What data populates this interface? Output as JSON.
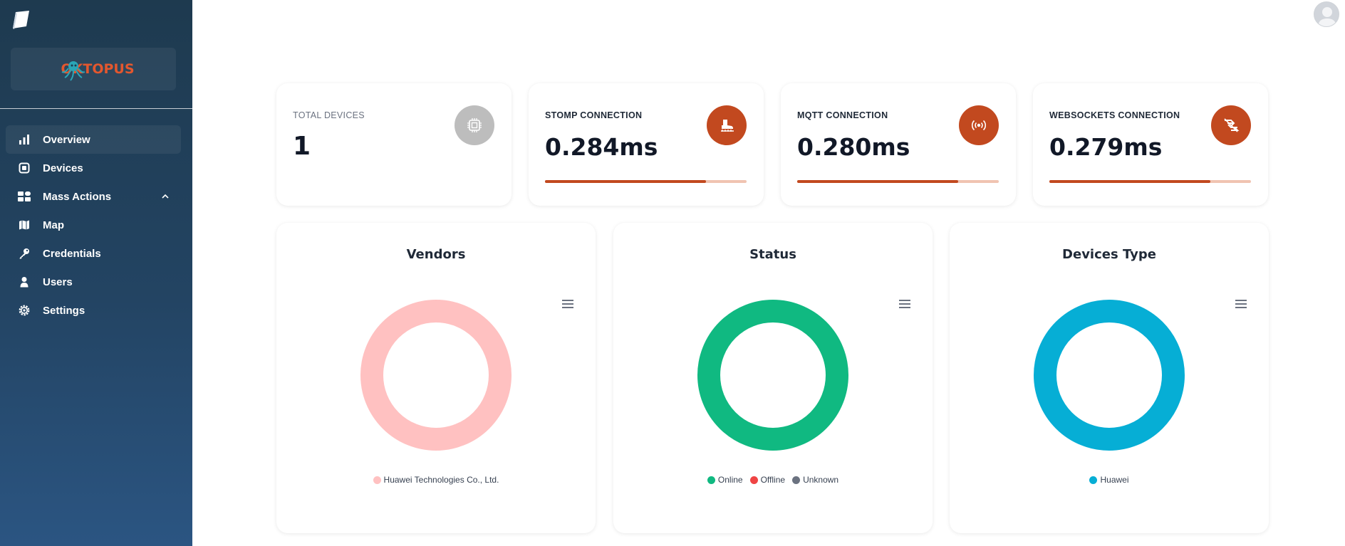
{
  "app": {
    "logo_text": "OKTOPUS"
  },
  "sidebar": {
    "items": [
      {
        "label": "Overview",
        "icon": "bar-chart-icon",
        "active": true
      },
      {
        "label": "Devices",
        "icon": "chip-icon"
      },
      {
        "label": "Mass Actions",
        "icon": "grid-icon",
        "expandable": true
      },
      {
        "label": "Map",
        "icon": "map-icon"
      },
      {
        "label": "Credentials",
        "icon": "key-icon"
      },
      {
        "label": "Users",
        "icon": "user-icon"
      },
      {
        "label": "Settings",
        "icon": "gear-icon"
      }
    ]
  },
  "stats": [
    {
      "label": "TOTAL DEVICES",
      "value": "1",
      "icon": "chip-icon",
      "badge_color": "#bdbdbd"
    },
    {
      "label": "STOMP CONNECTION",
      "value": "0.284ms",
      "icon": "stomp-icon",
      "badge_color": "#c2491f",
      "progress": 0.8
    },
    {
      "label": "MQTT CONNECTION",
      "value": "0.280ms",
      "icon": "broadcast-icon",
      "badge_color": "#c2491f",
      "progress": 0.8
    },
    {
      "label": "WEBSOCKETS CONNECTION",
      "value": "0.279ms",
      "icon": "websocket-icon",
      "badge_color": "#c2491f",
      "progress": 0.8
    }
  ],
  "charts": [
    {
      "title": "Vendors",
      "legend": [
        {
          "name": "Huawei Technologies Co., Ltd.",
          "color": "#ffc1c1"
        }
      ]
    },
    {
      "title": "Status",
      "legend": [
        {
          "name": "Online",
          "color": "#10b981"
        },
        {
          "name": "Offline",
          "color": "#ef4444"
        },
        {
          "name": "Unknown",
          "color": "#6b7280"
        }
      ]
    },
    {
      "title": "Devices Type",
      "legend": [
        {
          "name": "Huawei",
          "color": "#06aed5"
        }
      ]
    }
  ],
  "chart_data": [
    {
      "type": "pie",
      "title": "Vendors",
      "categories": [
        "Huawei Technologies Co., Ltd."
      ],
      "values": [
        1
      ],
      "donut": true
    },
    {
      "type": "pie",
      "title": "Status",
      "categories": [
        "Online",
        "Offline",
        "Unknown"
      ],
      "values": [
        1,
        0,
        0
      ],
      "donut": true
    },
    {
      "type": "pie",
      "title": "Devices Type",
      "categories": [
        "Huawei"
      ],
      "values": [
        1
      ],
      "donut": true
    }
  ]
}
